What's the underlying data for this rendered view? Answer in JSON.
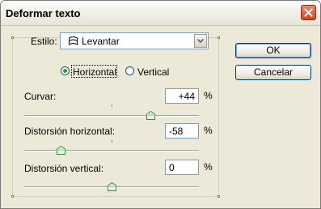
{
  "window": {
    "title": "Deformar texto"
  },
  "style_field": {
    "label": "Estilo:",
    "value": "Levantar",
    "icon": "warp-style-icon"
  },
  "orientation": {
    "options": [
      "Horizontal",
      "Vertical"
    ],
    "selected": "Horizontal"
  },
  "bend": {
    "label": "Curvar:",
    "value": "+44",
    "unit": "%",
    "level": 44
  },
  "horizontal_distortion": {
    "label": "Distorsión horizontal:",
    "value": "-58",
    "unit": "%",
    "level": -58
  },
  "vertical_distortion": {
    "label": "Distorsión vertical:",
    "value": "0",
    "unit": "%",
    "level": 0
  },
  "buttons": {
    "ok": "OK",
    "cancel": "Cancelar"
  },
  "colors": {
    "dialog_bg": "#ece9d8",
    "radio_selected": "#21a121",
    "close_button": "#c9482a",
    "button_border": "#003c74"
  }
}
